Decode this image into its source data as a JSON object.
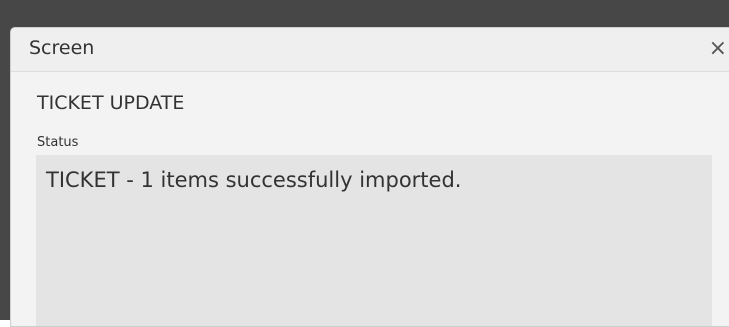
{
  "dialog": {
    "title": "Screen",
    "close_glyph": "×"
  },
  "content": {
    "section_title": "TICKET UPDATE",
    "status_label": "Status",
    "status_value": "TICKET - 1 items successfully imported."
  },
  "icons": {
    "close": "close-icon"
  },
  "colors": {
    "backdrop": "#474747",
    "dialog_background": "#f3f3f3",
    "status_box_background": "#e4e4e4",
    "text": "#333333"
  }
}
